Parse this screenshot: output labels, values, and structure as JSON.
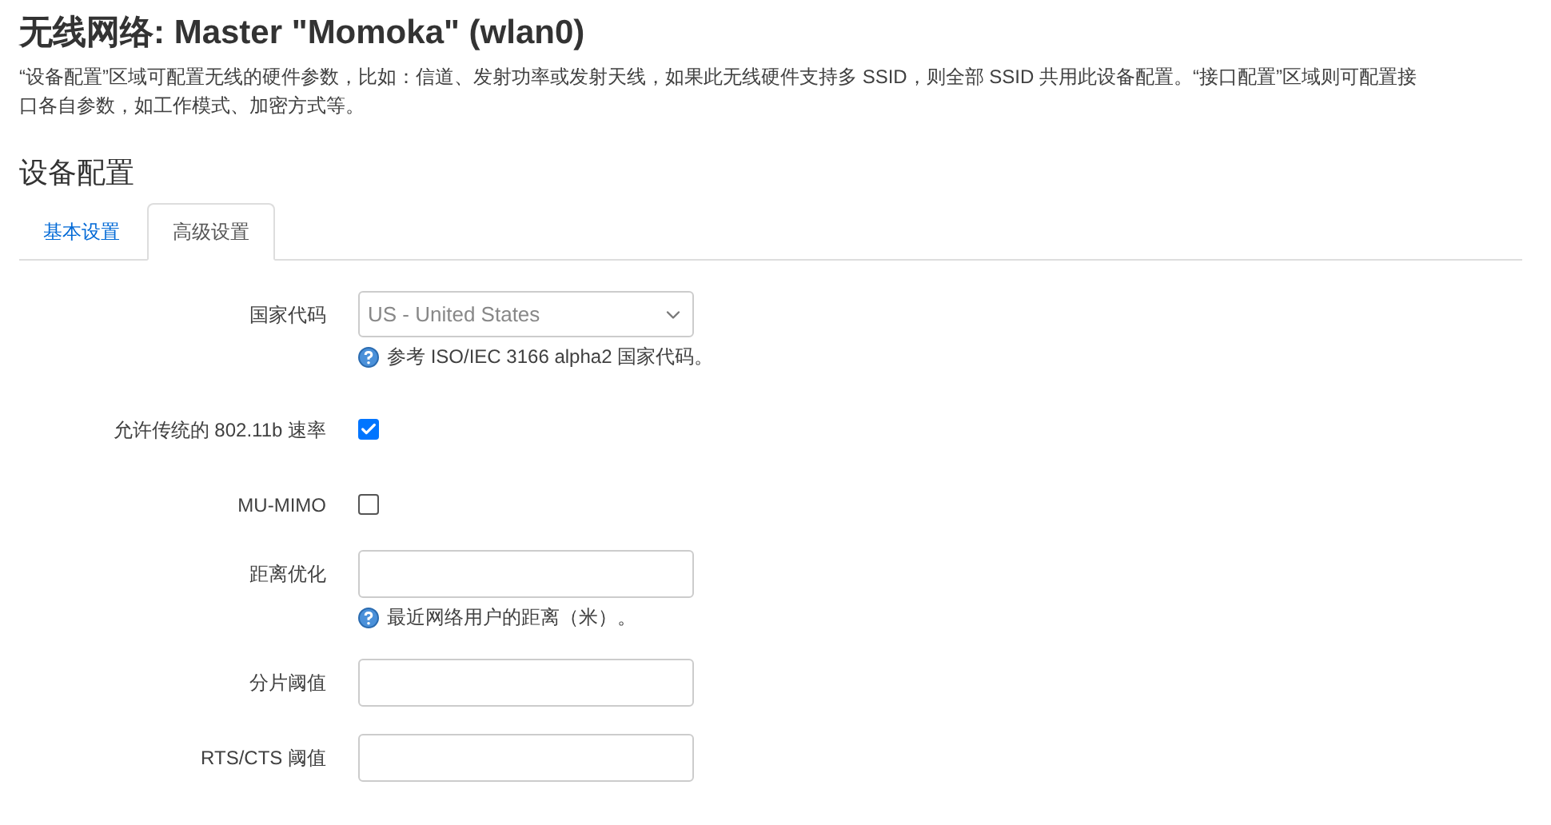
{
  "title": "无线网络: Master \"Momoka\" (wlan0)",
  "description": "“设备配置”区域可配置无线的硬件参数，比如：信道、发射功率或发射天线，如果此无线硬件支持多 SSID，则全部 SSID 共用此设备配置。“接口配置”区域则可配置接口各自参数，如工作模式、加密方式等。",
  "section": "设备配置",
  "tabs": [
    {
      "label": "基本设置",
      "selected": false
    },
    {
      "label": "高级设置",
      "selected": true
    }
  ],
  "fields": [
    {
      "kind": "select",
      "label": "国家代码",
      "value": "US - United States",
      "help": "参考 ISO/IEC 3166 alpha2 国家代码。"
    },
    {
      "kind": "checkbox",
      "label": "允许传统的 802.11b 速率",
      "checked": true
    },
    {
      "kind": "checkbox",
      "label": "MU-MIMO",
      "checked": false
    },
    {
      "kind": "text",
      "label": "距离优化",
      "help": "最近网络用户的距离（米）。"
    },
    {
      "kind": "text",
      "label": "分片阈值"
    },
    {
      "kind": "text",
      "label": "RTS/CTS 阈值"
    }
  ]
}
